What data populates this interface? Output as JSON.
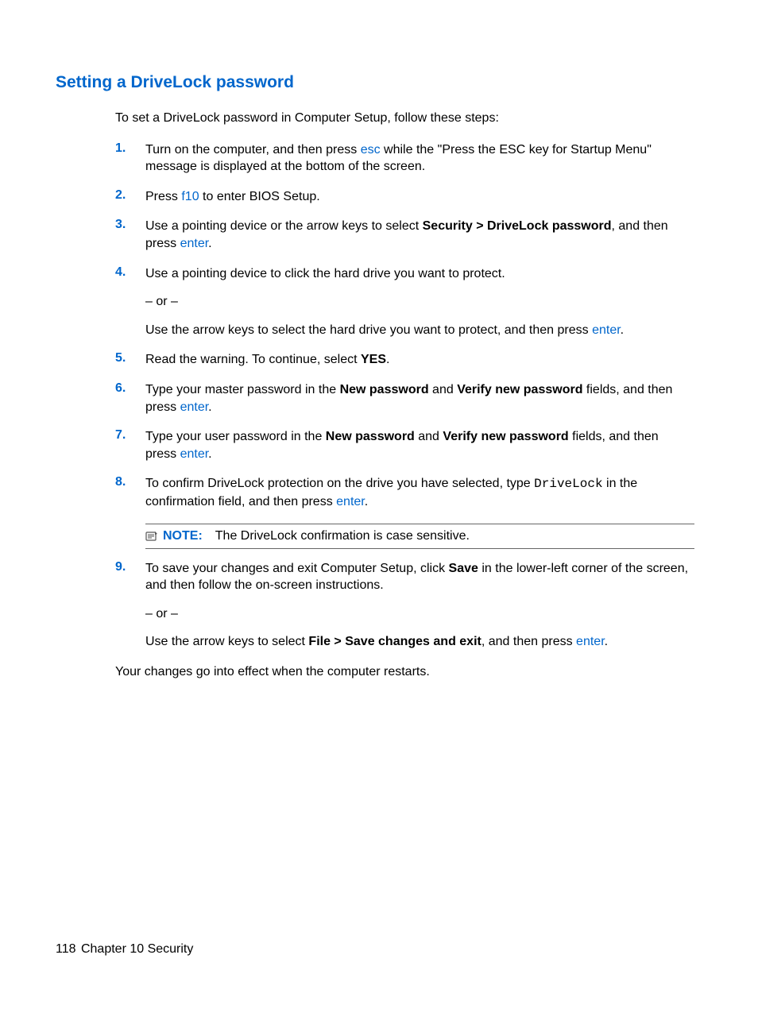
{
  "heading": "Setting a DriveLock password",
  "intro": "To set a DriveLock password in Computer Setup, follow these steps:",
  "steps": [
    {
      "num": "1.",
      "parts": [
        {
          "t": "Turn on the computer, and then press "
        },
        {
          "t": "esc",
          "cls": "hi"
        },
        {
          "t": " while the \"Press the ESC key for Startup Menu\" message is displayed at the bottom of the screen."
        }
      ]
    },
    {
      "num": "2.",
      "parts": [
        {
          "t": "Press "
        },
        {
          "t": "f10",
          "cls": "hi"
        },
        {
          "t": " to enter BIOS Setup."
        }
      ]
    },
    {
      "num": "3.",
      "parts": [
        {
          "t": "Use a pointing device or the arrow keys to select "
        },
        {
          "t": "Security > DriveLock password",
          "cls": "bold"
        },
        {
          "t": ", and then press "
        },
        {
          "t": "enter",
          "cls": "hi"
        },
        {
          "t": "."
        }
      ]
    },
    {
      "num": "4.",
      "paras": [
        [
          {
            "t": "Use a pointing device to click the hard drive you want to protect."
          }
        ],
        [
          {
            "t": "– or –"
          }
        ],
        [
          {
            "t": "Use the arrow keys to select the hard drive you want to protect, and then press "
          },
          {
            "t": "enter",
            "cls": "hi"
          },
          {
            "t": "."
          }
        ]
      ]
    },
    {
      "num": "5.",
      "parts": [
        {
          "t": "Read the warning. To continue, select "
        },
        {
          "t": "YES",
          "cls": "bold"
        },
        {
          "t": "."
        }
      ]
    },
    {
      "num": "6.",
      "parts": [
        {
          "t": "Type your master password in the "
        },
        {
          "t": "New password",
          "cls": "bold"
        },
        {
          "t": " and "
        },
        {
          "t": "Verify new password",
          "cls": "bold"
        },
        {
          "t": " fields, and then press "
        },
        {
          "t": "enter",
          "cls": "hi"
        },
        {
          "t": "."
        }
      ]
    },
    {
      "num": "7.",
      "parts": [
        {
          "t": "Type your user password in the "
        },
        {
          "t": "New password",
          "cls": "bold"
        },
        {
          "t": " and "
        },
        {
          "t": "Verify new password",
          "cls": "bold"
        },
        {
          "t": " fields, and then press "
        },
        {
          "t": "enter",
          "cls": "hi"
        },
        {
          "t": "."
        }
      ]
    },
    {
      "num": "8.",
      "parts": [
        {
          "t": "To confirm DriveLock protection on the drive you have selected, type "
        },
        {
          "t": "DriveLock",
          "cls": "mono"
        },
        {
          "t": " in the confirmation field, and then press "
        },
        {
          "t": "enter",
          "cls": "hi"
        },
        {
          "t": "."
        }
      ],
      "note": {
        "label": "NOTE:",
        "text": "The DriveLock confirmation is case sensitive."
      }
    },
    {
      "num": "9.",
      "paras": [
        [
          {
            "t": "To save your changes and exit Computer Setup, click "
          },
          {
            "t": "Save",
            "cls": "bold"
          },
          {
            "t": " in the lower-left corner of the screen, and then follow the on-screen instructions."
          }
        ],
        [
          {
            "t": "– or –"
          }
        ],
        [
          {
            "t": "Use the arrow keys to select "
          },
          {
            "t": "File > Save changes and exit",
            "cls": "bold"
          },
          {
            "t": ", and then press "
          },
          {
            "t": "enter",
            "cls": "hi"
          },
          {
            "t": "."
          }
        ]
      ]
    }
  ],
  "closing": "Your changes go into effect when the computer restarts.",
  "footer": {
    "page": "118",
    "chapter": "Chapter 10   Security"
  }
}
